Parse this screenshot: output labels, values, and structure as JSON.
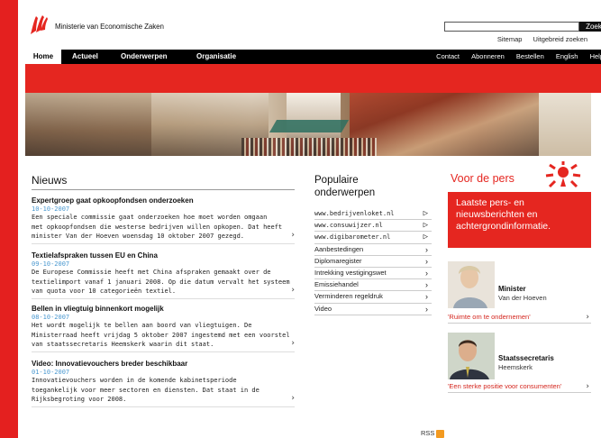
{
  "header": {
    "ministry_name": "Ministerie van Economische Zaken",
    "search": {
      "placeholder": "",
      "button_label": "Zoek"
    },
    "top_links": [
      "Sitemap",
      "Uitgebreid zoeken"
    ]
  },
  "nav": {
    "main": [
      "Home",
      "Actueel",
      "Onderwerpen",
      "Organisatie"
    ],
    "right": [
      "Contact",
      "Abonneren",
      "Bestellen",
      "English",
      "Help"
    ]
  },
  "news": {
    "title": "Nieuws",
    "items": [
      {
        "title": "Expertgroep gaat opkoopfondsen onderzoeken",
        "date": "10-10-2007",
        "lines": [
          "Een speciale commissie gaat onderzoeken hoe moet worden omgaan",
          "met opkoopfondsen die westerse bedrijven willen opkopen. Dat heeft",
          "minister Van der Hoeven woensdag 10 oktober 2007 gezegd."
        ]
      },
      {
        "title": "Textielafspraken tussen EU en China",
        "date": "09-10-2007",
        "lines": [
          "De Europese Commissie heeft met China afspraken gemaakt over de",
          "textielimport vanaf 1 januari 2008. Op die datum vervalt het systeem",
          "van quota voor 10 categorieën textiel."
        ]
      },
      {
        "title": "Bellen in vliegtuig binnenkort mogelijk",
        "date": "08-10-2007",
        "lines": [
          "Het wordt mogelijk te bellen aan boord van vliegtuigen. De",
          "Ministerraad heeft vrijdag 5 oktober 2007 ingestemd met een voorstel",
          "van staatssecretaris Heemskerk waarin dit staat."
        ]
      },
      {
        "title": "Video: Innovatievouchers breder beschikbaar",
        "date": "01-10-2007",
        "lines": [
          "Innovatievouchers worden in de komende kabinetsperiode",
          "toegankelijk voor meer sectoren en diensten. Dat staat in de",
          "Rijksbegroting voor 2008."
        ]
      }
    ]
  },
  "popular": {
    "title_line1": "Populaire",
    "title_line2": "onderwerpen",
    "items": [
      "www.bedrijvenloket.nl",
      "www.consuwijzer.nl",
      "www.digibarometer.nl",
      "Aanbestedingen",
      "Diplomaregister",
      "Intrekking vestigingswet",
      "Emissiehandel",
      "Verminderen regeldruk",
      "Video"
    ]
  },
  "press": {
    "title": "Voor de pers",
    "box_lines": [
      "Laatste pers- en",
      "nieuwsberichten en",
      "achtergrondinformatie."
    ]
  },
  "people": [
    {
      "role": "Minister",
      "name": "Van der Hoeven",
      "quote": "'Ruimte om te ondernemen'"
    },
    {
      "role": "Staatssecretaris",
      "name": "Heemskerk",
      "quote": "'Een sterke positie voor consumenten'"
    }
  ],
  "footer": {
    "rss_label": "RSS"
  },
  "colors": {
    "brand_red": "#e52620",
    "date_blue": "#4a98d0"
  }
}
